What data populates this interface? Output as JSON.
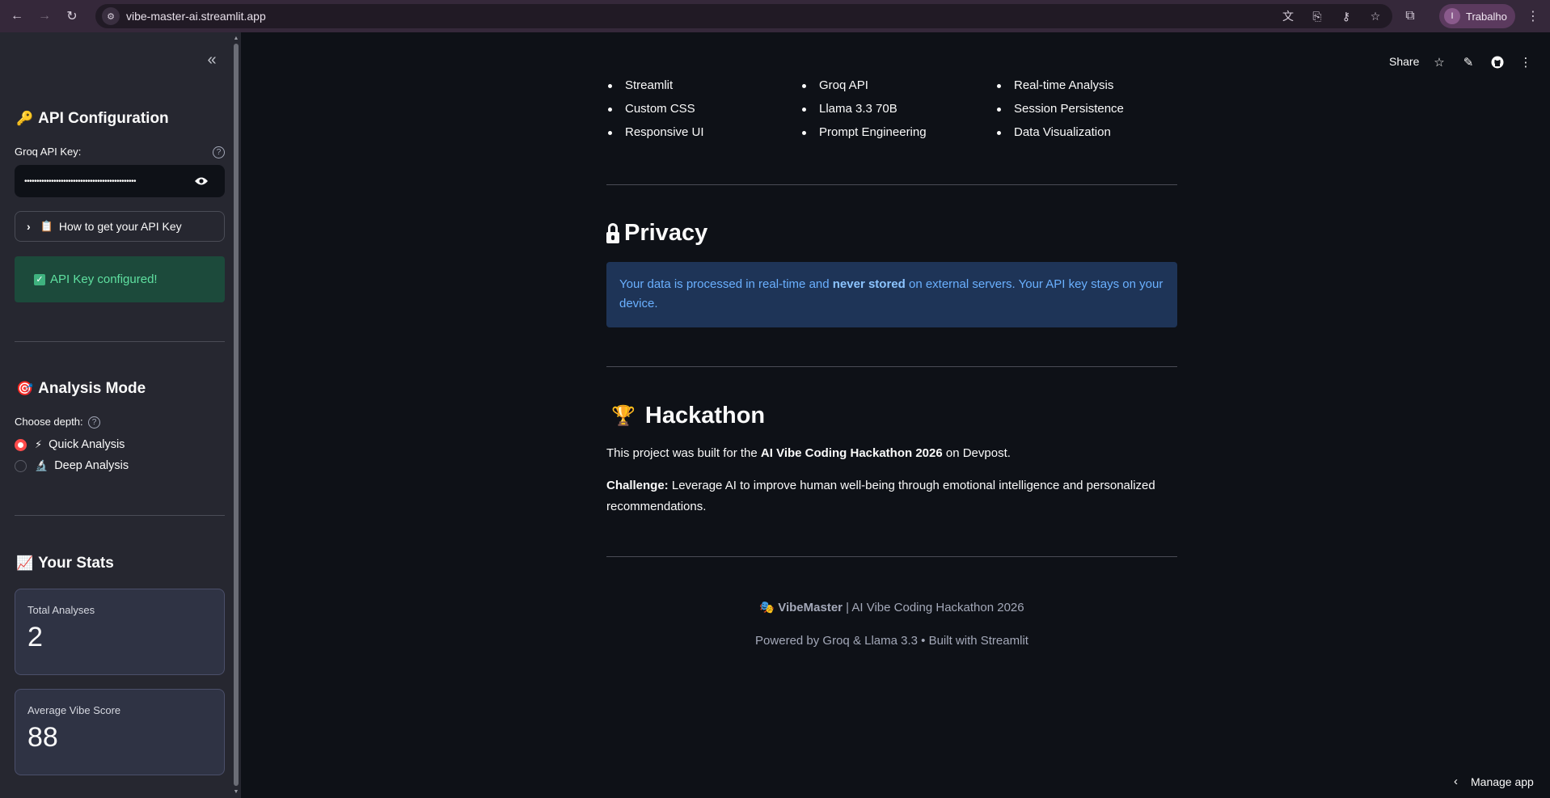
{
  "browser": {
    "url": "vibe-master-ai.streamlit.app",
    "profile_initial": "I",
    "profile_name": "Trabalho"
  },
  "sidebar": {
    "api_config": {
      "emoji": "🔑",
      "heading": "API Configuration",
      "key_label": "Groq API Key:",
      "key_value": "••••••••••••••••••••••••••••••••••••••••••••••",
      "expander_emoji": "📋",
      "expander_label": "How to get your API Key",
      "success_text": "API Key configured!"
    },
    "analysis_mode": {
      "emoji": "🎯",
      "heading": "Analysis Mode",
      "depth_label": "Choose depth:",
      "options": [
        {
          "emoji": "⚡",
          "label": "Quick Analysis",
          "selected": true
        },
        {
          "emoji": "🔬",
          "label": "Deep Analysis",
          "selected": false
        }
      ]
    },
    "stats": {
      "emoji": "📈",
      "heading": "Your Stats",
      "metrics": [
        {
          "label": "Total Analyses",
          "value": "2"
        },
        {
          "label": "Average Vibe Score",
          "value": "88"
        }
      ]
    }
  },
  "toolbar": {
    "share_label": "Share"
  },
  "main": {
    "tech_columns": [
      [
        "Streamlit",
        "Custom CSS",
        "Responsive UI"
      ],
      [
        "Groq API",
        "Llama 3.3 70B",
        "Prompt Engineering"
      ],
      [
        "Real-time Analysis",
        "Session Persistence",
        "Data Visualization"
      ]
    ],
    "privacy": {
      "heading": "Privacy",
      "text_before": "Your data is processed in real-time and ",
      "text_bold": "never stored",
      "text_after": " on external servers. Your API key stays on your device."
    },
    "hackathon": {
      "emoji": "🏆",
      "heading": "Hackathon",
      "p1_before": "This project was built for the ",
      "p1_bold": "AI Vibe Coding Hackathon 2026",
      "p1_after": " on Devpost.",
      "p2_bold": "Challenge:",
      "p2_after": " Leverage AI to improve human well-being through emotional intelligence and personalized recommendations."
    },
    "footer": {
      "emoji": "🎭",
      "brand": "VibeMaster",
      "line1_after": " | AI Vibe Coding Hackathon 2026",
      "line2": "Powered by Groq & Llama 3.3 • Built with Streamlit"
    },
    "manage_app_label": "Manage app"
  },
  "colors": {
    "background": "#0e1117",
    "sidebar": "#262730",
    "accent": "#ff4b4b",
    "success_bg": "#1c4a3b",
    "info_bg": "#1e3457"
  }
}
